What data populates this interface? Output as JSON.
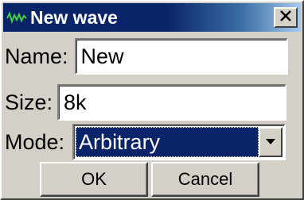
{
  "window": {
    "title": "New wave",
    "title_icon": "waveform-icon",
    "close_icon": "close-icon",
    "colors": {
      "titlebar": "#0a246a",
      "face": "#d4d0c8",
      "selection": "#0a246a"
    }
  },
  "form": {
    "name_label": "Name:",
    "name_value": "New",
    "size_label": "Size:",
    "size_value": "8k",
    "mode_label": "Mode:",
    "mode_value": "Arbitrary",
    "mode_arrow_icon": "chevron-down-icon"
  },
  "buttons": {
    "ok_label": "OK",
    "cancel_label": "Cancel"
  }
}
